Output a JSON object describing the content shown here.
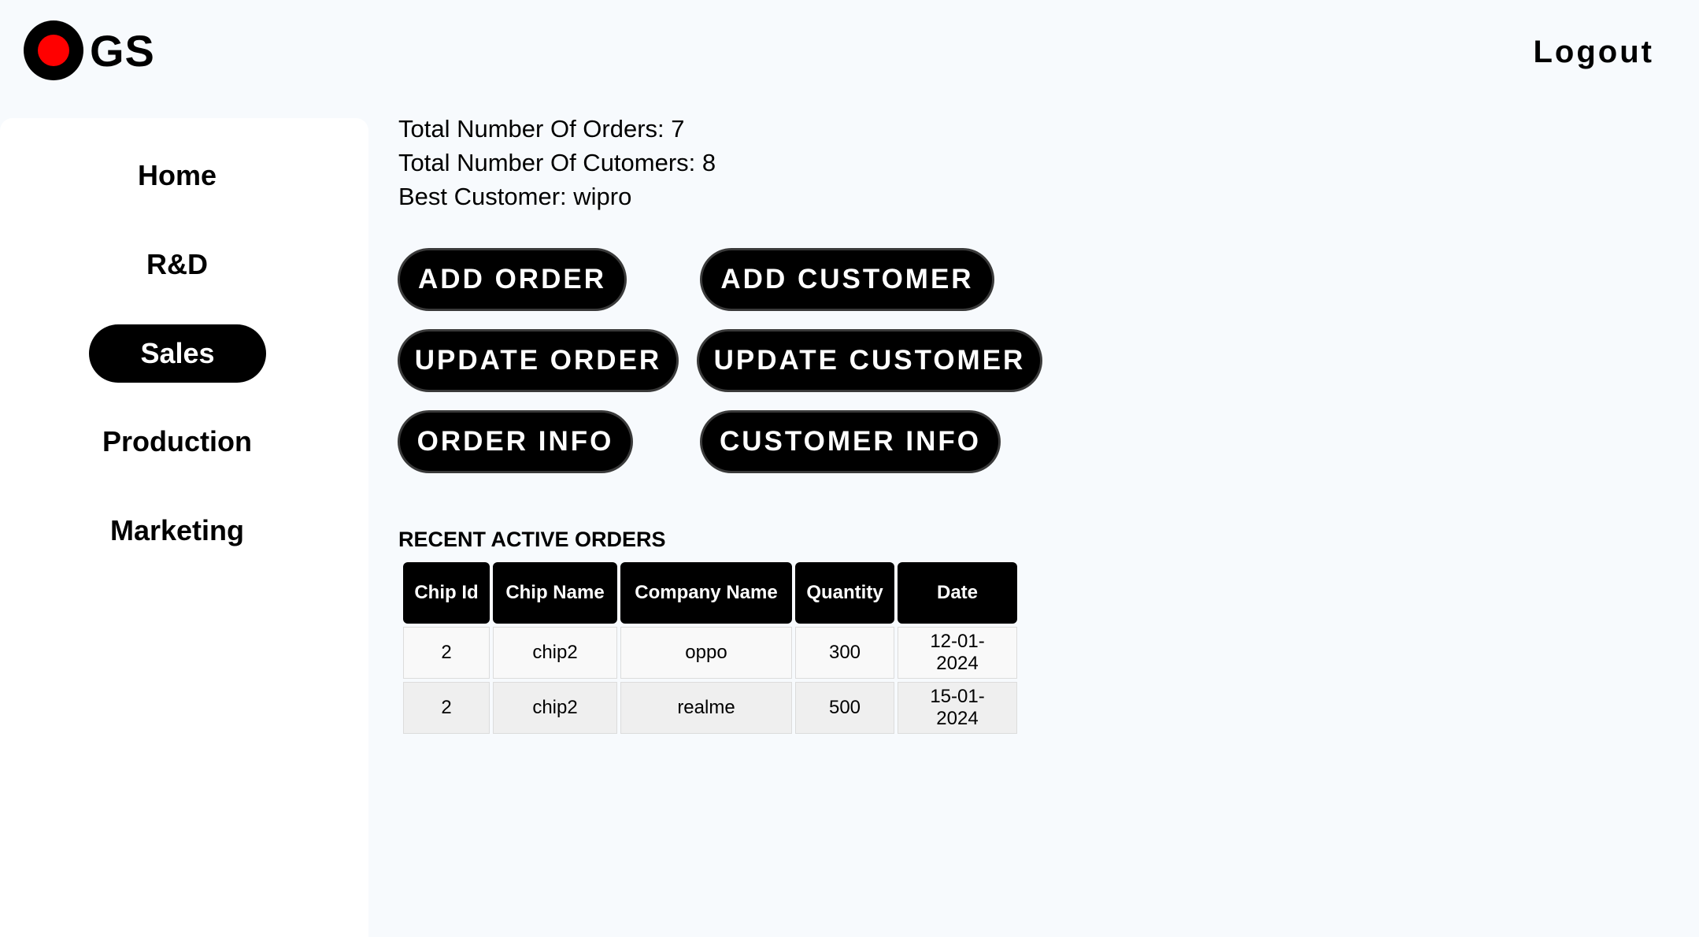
{
  "header": {
    "logo_text": "GS",
    "logout_label": "Logout"
  },
  "sidebar": {
    "items": [
      {
        "label": "Home"
      },
      {
        "label": "R&D"
      },
      {
        "label": "Sales",
        "active": true
      },
      {
        "label": "Production"
      },
      {
        "label": "Marketing"
      }
    ]
  },
  "stats": {
    "total_orders": "Total Number Of Orders: 7",
    "total_customers": "Total Number Of Cutomers: 8",
    "best_customer": "Best Customer: wipro"
  },
  "actions": {
    "add_order": "ADD ORDER",
    "add_customer": "ADD CUSTOMER",
    "update_order": "UPDATE ORDER",
    "update_customer": "UPDATE CUSTOMER",
    "order_info": "ORDER INFO",
    "customer_info": "CUSTOMER INFO"
  },
  "recent_orders": {
    "title": "RECENT ACTIVE ORDERS",
    "columns": [
      "Chip Id",
      "Chip Name",
      "Company Name",
      "Quantity",
      "Date"
    ],
    "rows": [
      [
        "2",
        "chip2",
        "oppo",
        "300",
        "12-01-2024"
      ],
      [
        "2",
        "chip2",
        "realme",
        "500",
        "15-01-2024"
      ]
    ]
  },
  "colors": {
    "accent": "#000000",
    "logo_dot": "#ff0000",
    "background": "#f7fafd"
  }
}
